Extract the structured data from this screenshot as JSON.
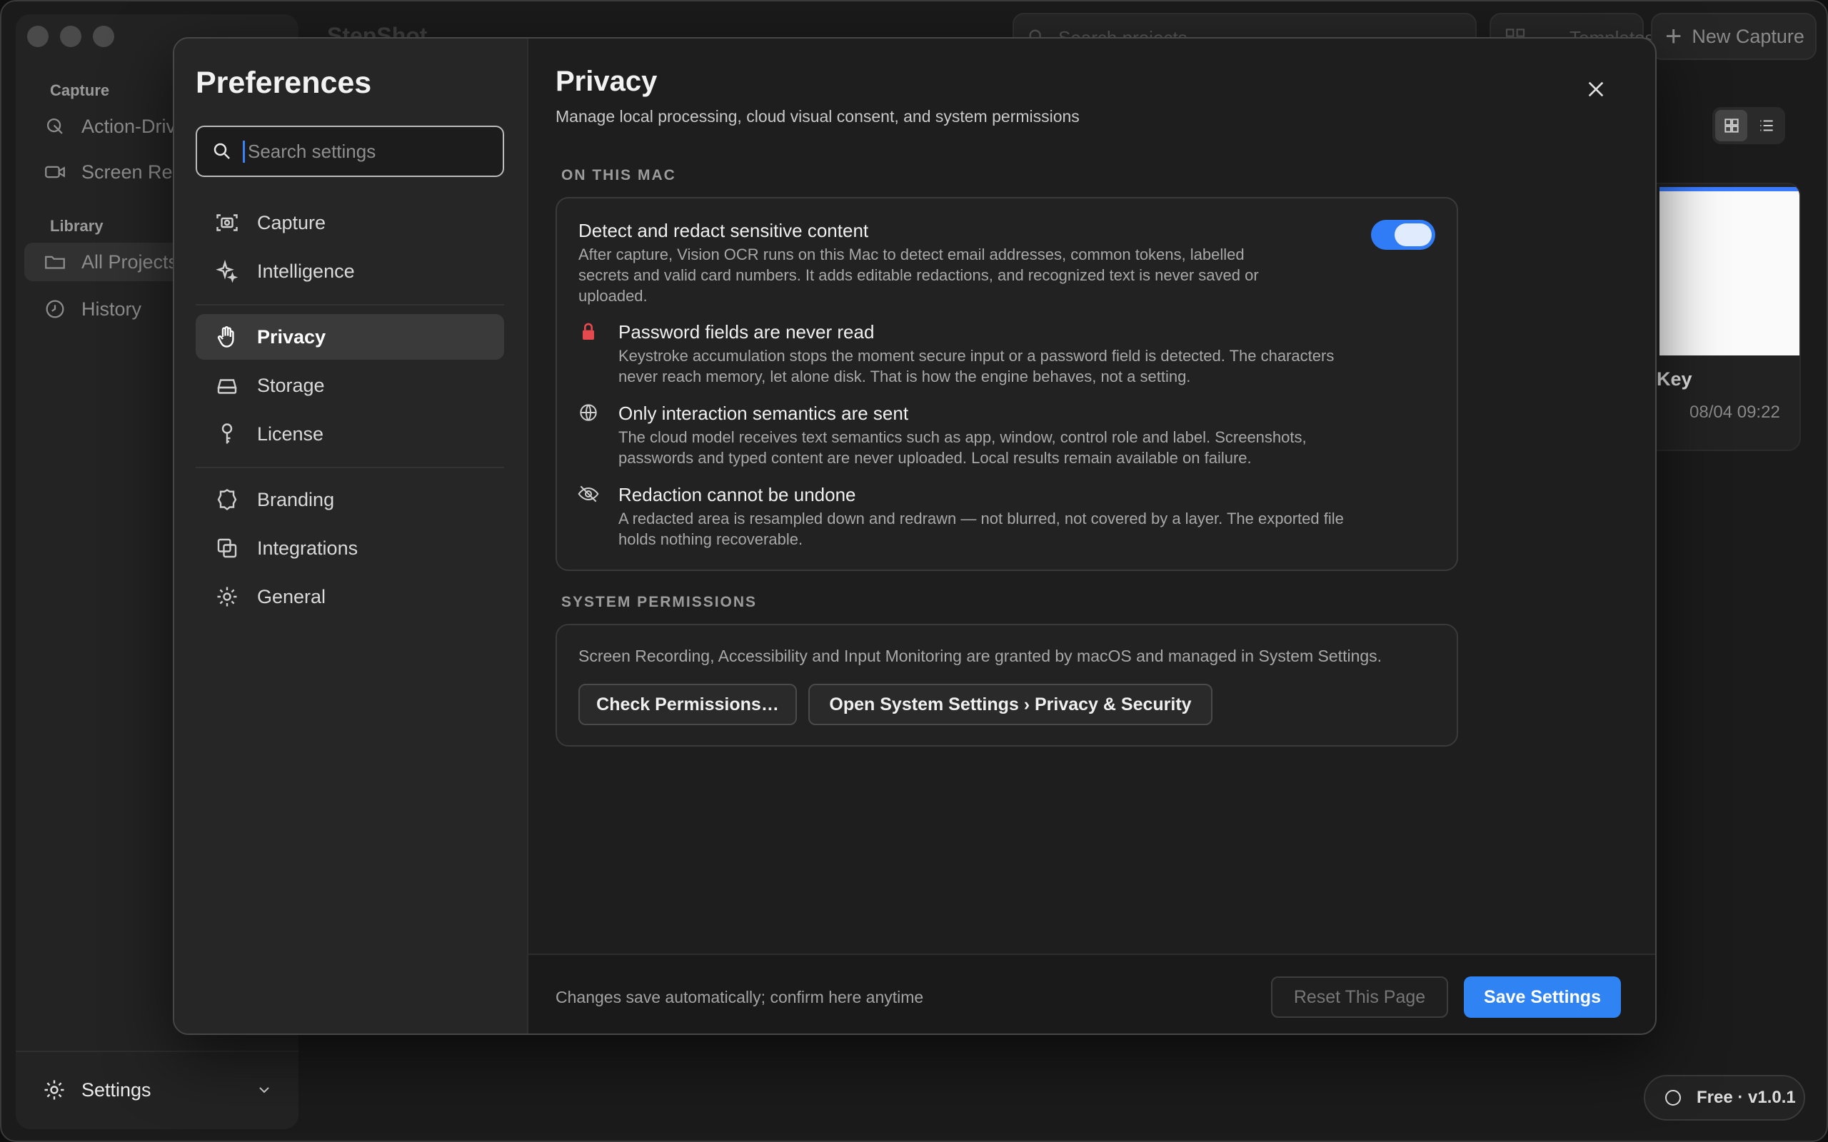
{
  "app": {
    "title": "StepShot",
    "search_placeholder": "Search projects",
    "templates_label": "Templates",
    "new_capture_label": "New Capture",
    "plan_badge": "Free · v1.0.1"
  },
  "sidebar": {
    "sections": [
      {
        "label": "Capture",
        "items": [
          {
            "label": "Action-Driven",
            "icon": "cursor-click-icon"
          },
          {
            "label": "Screen Recording",
            "icon": "video-camera-icon"
          }
        ]
      },
      {
        "label": "Library",
        "items": [
          {
            "label": "All Projects",
            "icon": "folder-icon",
            "active": true
          },
          {
            "label": "History",
            "icon": "clock-icon"
          }
        ]
      }
    ],
    "settings_label": "Settings"
  },
  "project_card": {
    "name": "Key",
    "date": "08/04 09:22"
  },
  "preferences": {
    "title": "Preferences",
    "search_placeholder": "Search settings",
    "nav": [
      {
        "label": "Capture",
        "icon": "camera-icon"
      },
      {
        "label": "Intelligence",
        "icon": "sparkles-icon"
      },
      {
        "label": "Privacy",
        "icon": "hand-icon",
        "active": true
      },
      {
        "label": "Storage",
        "icon": "drive-icon"
      },
      {
        "label": "License",
        "icon": "key-icon"
      },
      {
        "label": "Branding",
        "icon": "badge-icon"
      },
      {
        "label": "Integrations",
        "icon": "copy-icon"
      },
      {
        "label": "General",
        "icon": "gear-icon"
      }
    ],
    "page": {
      "title": "Privacy",
      "subtitle": "Manage local processing, cloud visual consent, and system permissions",
      "on_this_mac": {
        "section_label": "ON THIS MAC",
        "toggle": {
          "title": "Detect and redact sensitive content",
          "description_lines": [
            "After capture, Vision OCR runs on this Mac to detect email addresses, common tokens, labelled",
            "secrets and valid card numbers. It adds editable redactions, and recognized text is never saved or",
            "uploaded."
          ],
          "enabled": true
        },
        "rows": [
          {
            "icon": "lock-icon",
            "title": "Password fields are never read",
            "description_lines": [
              "Keystroke accumulation stops the moment secure input or a password field is detected. The characters",
              "never reach memory, let alone disk. That is how the engine behaves, not a setting."
            ]
          },
          {
            "icon": "globe-icon",
            "title": "Only interaction semantics are sent",
            "description_lines": [
              "The cloud model receives text semantics such as app, window, control role and label. Screenshots,",
              "passwords and typed content are never uploaded. Local results remain available on failure."
            ]
          },
          {
            "icon": "eye-slash-icon",
            "title": "Redaction cannot be undone",
            "description_lines": [
              "A redacted area is resampled down and redrawn — not blurred, not covered by a layer. The exported file",
              "holds nothing recoverable."
            ]
          }
        ]
      },
      "system_permissions": {
        "section_label": "SYSTEM PERMISSIONS",
        "text": "Screen Recording, Accessibility and Input Monitoring are granted by macOS and managed in System Settings.",
        "check_label": "Check Permissions…",
        "open_label": "Open System Settings › Privacy & Security"
      }
    },
    "footer": {
      "note": "Changes save automatically; confirm here anytime",
      "reset_label": "Reset This Page",
      "save_label": "Save Settings"
    }
  },
  "colors": {
    "accent": "#2f83f3",
    "lock_red": "#e5484d"
  }
}
